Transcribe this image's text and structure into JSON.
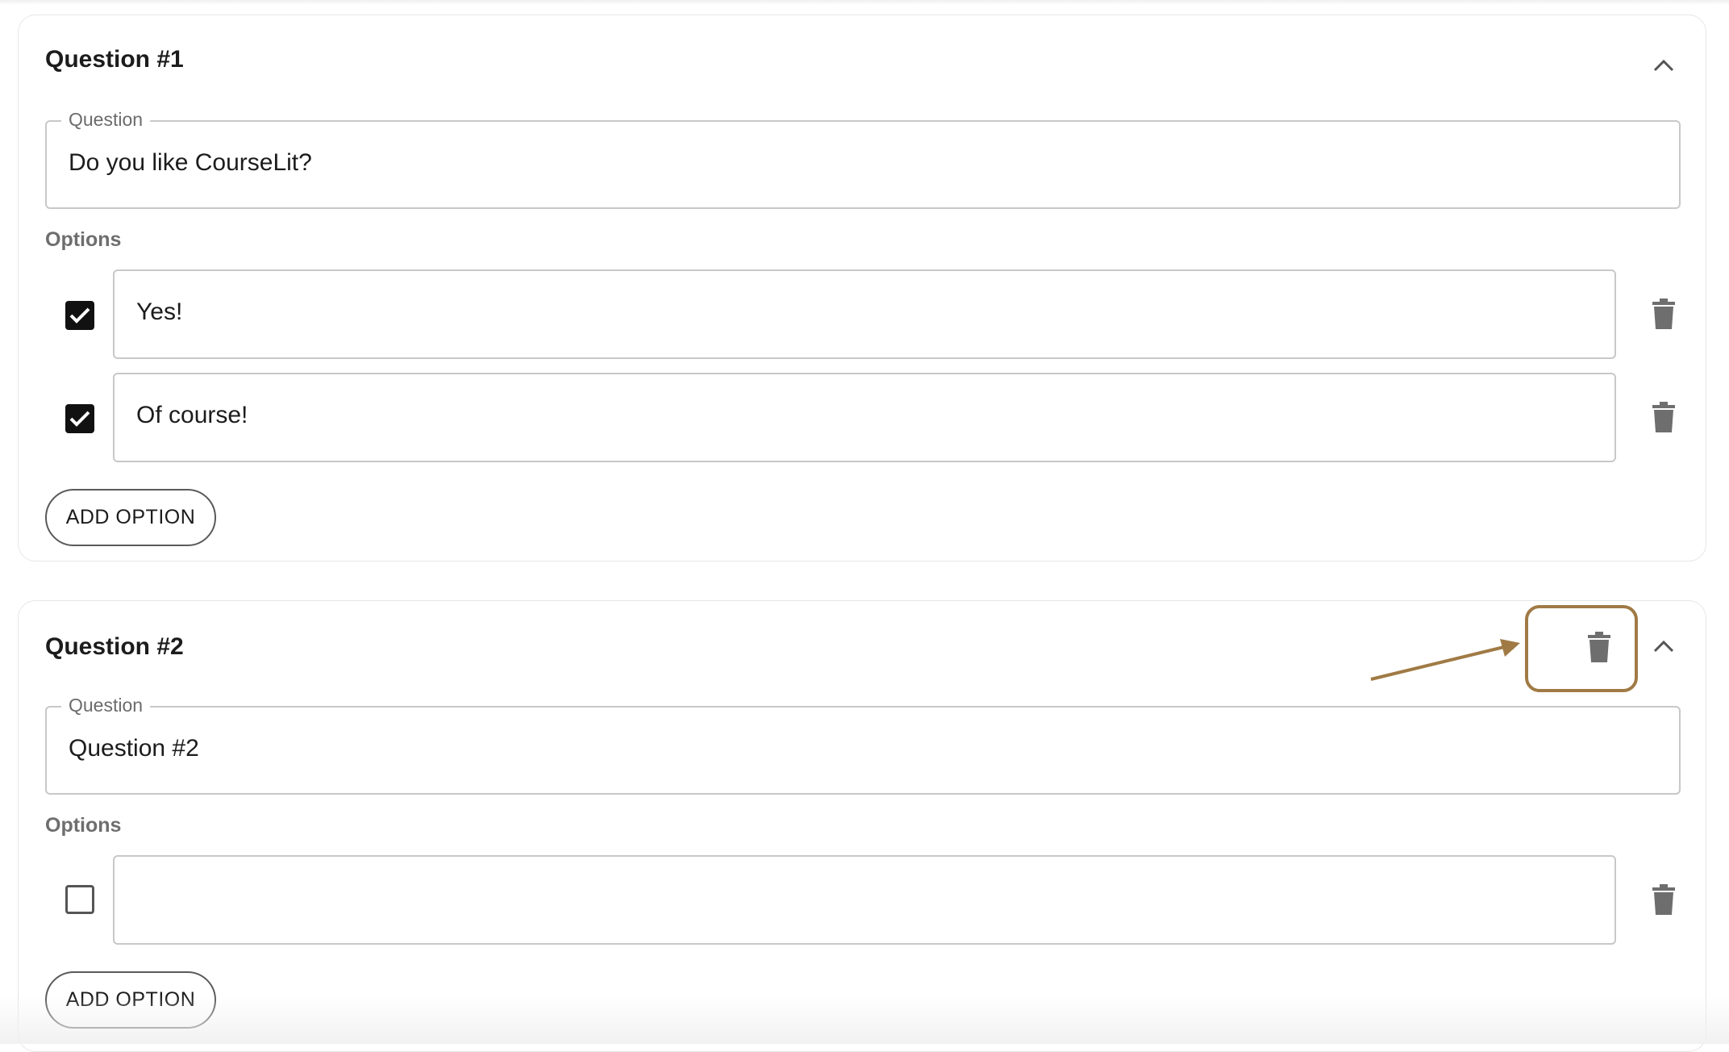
{
  "questions": [
    {
      "title": "Question #1",
      "question_label": "Question",
      "question_value": "Do you like CourseLit?",
      "options_label": "Options",
      "options": [
        {
          "text": "Yes!",
          "checked": true
        },
        {
          "text": "Of course!",
          "checked": true
        }
      ],
      "add_option_label": "ADD OPTION"
    },
    {
      "title": "Question #2",
      "question_label": "Question",
      "question_value": "Question #2",
      "options_label": "Options",
      "options": [
        {
          "text": "",
          "checked": false
        }
      ],
      "add_option_label": "ADD OPTION"
    }
  ],
  "icons": {
    "collapse": "chevron-up-icon",
    "delete": "trash-icon",
    "checked": "checkbox-checked-icon",
    "unchecked": "checkbox-unchecked-icon"
  },
  "annotation": {
    "highlight_color": "#a07a45",
    "target": "delete-question-button"
  },
  "colors": {
    "icon_gray": "#6e6e6e",
    "border": "#c8c8c8",
    "checkbox_checked": "#111111"
  }
}
